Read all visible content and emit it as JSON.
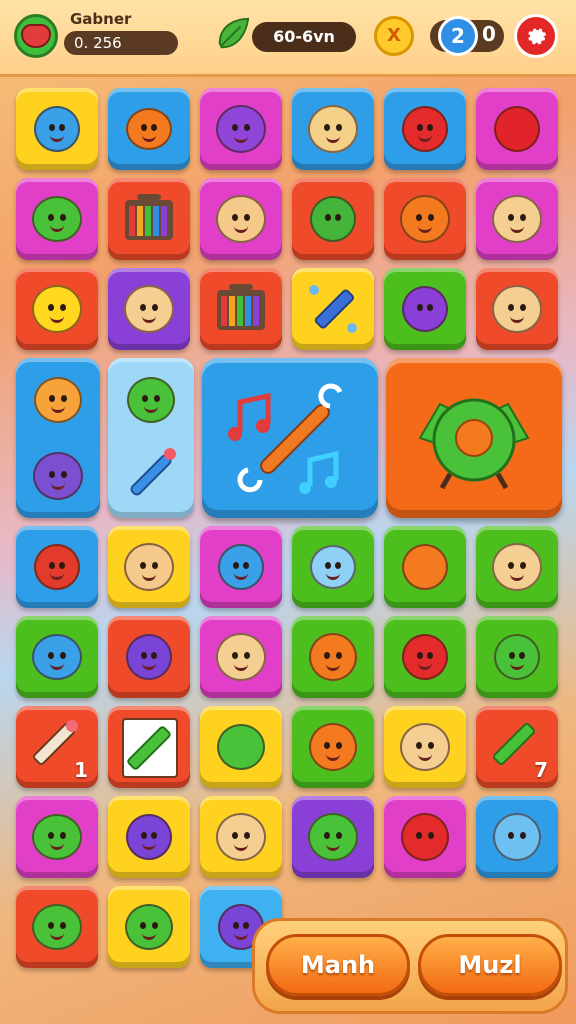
{
  "hud": {
    "player_name": "Gabner",
    "score": "0.  256",
    "timer": "60-6vn",
    "x_label": "X",
    "count_value": "2",
    "count_extra": "0",
    "avatar_icon": "avatar-creature-icon",
    "leaf_icon": "leaf-icon",
    "settings_icon": "gear-icon"
  },
  "board": {
    "pencil_tile_1_count": "1",
    "pencil_tile_2_count": "7",
    "music_tile_icon": "music-notes-icon",
    "big_creature_icon": "green-orb-creature-icon"
  },
  "buttons": {
    "left_label": "Manh",
    "right_label": "Muzl"
  },
  "colors": {
    "yellow": "#ffd21f",
    "blue": "#2f9ee8",
    "magenta": "#e23fc8",
    "red": "#ef4b2a",
    "orange": "#f46a18",
    "green": "#4cbf1e",
    "purple": "#8a3fd6"
  }
}
